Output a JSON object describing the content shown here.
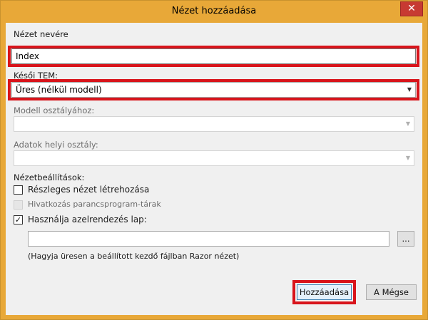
{
  "window": {
    "title": "Nézet hozzáadása",
    "close_glyph": "✕"
  },
  "view_name": {
    "label": "Nézet nevére",
    "value": "Index"
  },
  "template": {
    "label": "Késői TEM:",
    "selected": "Üres (nélkül modell)"
  },
  "model_class": {
    "label": "Modell osztályához:",
    "selected": ""
  },
  "data_context": {
    "label": "Adatok helyi osztály:",
    "selected": ""
  },
  "options": {
    "label": "Nézetbeállítások:",
    "partial": {
      "label": "Részleges nézet létrehozása",
      "checked": false
    },
    "reference_scripts": {
      "label": "Hivatkozás parancsprogram-tárak",
      "checked": false,
      "enabled": false
    },
    "use_layout": {
      "label": "Használja azelrendezés lap:",
      "checked": true,
      "check_glyph": "✓"
    }
  },
  "layout_page": {
    "value": "",
    "browse_label": "...",
    "hint": "(Hagyja üresen a beállított kezdő fájlban Razor nézet)"
  },
  "buttons": {
    "add": "Hozzáadása",
    "cancel": "A Mégse"
  },
  "icons": {
    "dropdown": "chevron-down-icon",
    "close": "close-icon"
  },
  "colors": {
    "accent_frame": "#e8a838",
    "highlight": "#d8141b",
    "close_button": "#c73a32"
  }
}
